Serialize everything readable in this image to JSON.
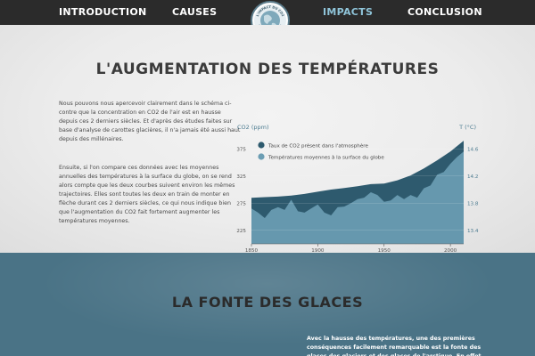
{
  "nav": {
    "items": [
      {
        "label": "INTRODUCTION",
        "active": false
      },
      {
        "label": "CAUSES",
        "active": false
      },
      {
        "label": "IMPACTS",
        "active": true
      },
      {
        "label": "CONCLUSION",
        "active": false
      }
    ],
    "logo_top_text": "L'IMPACT DU CO2",
    "logo_bottom_text": "SUR NOTRE PLANÈTE"
  },
  "colors": {
    "nav_bg": "#2b2b2b",
    "active": "#8fc4d9",
    "co2_area": "#2e5a6e",
    "temp_area": "#6b9db3",
    "section2_bg": "#4a7386"
  },
  "section1": {
    "title": "L'AUGMENTATION DES TEMPÉRATURES",
    "paragraph1": "Nous pouvons nous apercevoir clairement dans le schéma ci-contre que la concentration en CO2 de l'air est en hausse depuis ces 2 derniers siècles. Et d'après des études faites sur base d'analyse de carottes glacières, il n'a jamais été aussi haut depuis des millénaires.",
    "paragraph2": "Ensuite, si l'on compare ces données avec les moyennes annuelles des températures à la surface du globe, on se rend alors compte que les deux courbes suivent environ les mêmes trajectoires. Elles sont toutes les deux en train de monter en flèche durant ces 2 derniers siècles, ce qui nous indique bien que l'augmentation du CO2 fait fortement augmenter les températures moyennes."
  },
  "chart_data": {
    "type": "area",
    "ylabel": "CO2 (ppm)",
    "y2label": "T (°C)",
    "x_ticks": [
      1850,
      1900,
      1950,
      2000
    ],
    "y_ticks": [
      225,
      275,
      325,
      375
    ],
    "y2_ticks": [
      13.4,
      13.8,
      14.2,
      14.6
    ],
    "xlim": [
      1850,
      2010
    ],
    "ylim": [
      200,
      400
    ],
    "y2lim": [
      13.2,
      14.8
    ],
    "legend_position": "top-left",
    "series": [
      {
        "name": "Taux de CO2 présent dans l'atmosphère",
        "axis": "left",
        "x": [
          1850,
          1860,
          1870,
          1880,
          1890,
          1900,
          1910,
          1920,
          1930,
          1940,
          1950,
          1960,
          1970,
          1980,
          1990,
          2000,
          2010
        ],
        "values": [
          285,
          286,
          287,
          289,
          292,
          296,
          300,
          303,
          306,
          310,
          311,
          317,
          326,
          339,
          354,
          370,
          390
        ]
      },
      {
        "name": "Températures moyennes à la surface du globe",
        "axis": "right",
        "x": [
          1850,
          1855,
          1860,
          1865,
          1870,
          1875,
          1880,
          1885,
          1890,
          1895,
          1900,
          1905,
          1910,
          1915,
          1920,
          1925,
          1930,
          1935,
          1940,
          1945,
          1950,
          1955,
          1960,
          1965,
          1970,
          1975,
          1980,
          1985,
          1990,
          1995,
          2000,
          2005,
          2010
        ],
        "values": [
          13.72,
          13.66,
          13.58,
          13.7,
          13.74,
          13.7,
          13.85,
          13.68,
          13.66,
          13.72,
          13.78,
          13.66,
          13.62,
          13.74,
          13.75,
          13.8,
          13.86,
          13.88,
          13.96,
          13.92,
          13.82,
          13.84,
          13.92,
          13.86,
          13.92,
          13.88,
          14.02,
          14.06,
          14.22,
          14.26,
          14.38,
          14.48,
          14.56
        ]
      }
    ]
  },
  "section2": {
    "title": "LA FONTE DES GLACES",
    "paragraph": "Avec la hausse des températures, une des premières conséquences facilement remarquable est la fonte des glaces des glaciers et des glaces de l'arctique. En effet, la"
  }
}
